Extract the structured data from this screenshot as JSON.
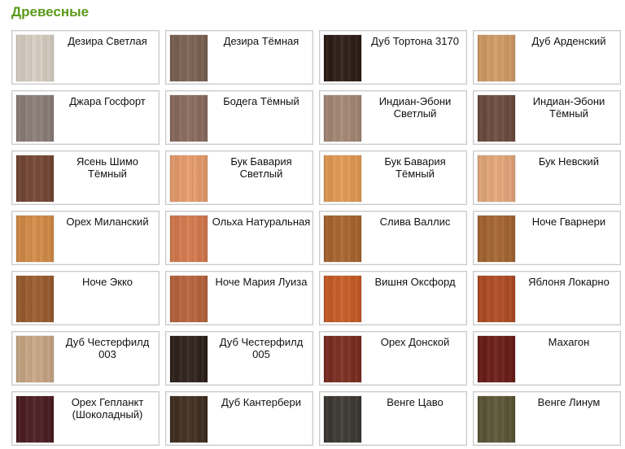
{
  "page": {
    "title": "Древесные"
  },
  "items": [
    {
      "name": "Дезира Светлая",
      "color": "#d9d0c3"
    },
    {
      "name": "Дезира Тёмная",
      "color": "#7a6150"
    },
    {
      "name": "Дуб Тортона 3170",
      "color": "#2a1a12"
    },
    {
      "name": "Дуб Арденский",
      "color": "#d29a62"
    },
    {
      "name": "Джара Госфорт",
      "color": "#8a7d77"
    },
    {
      "name": "Бодега Тёмный",
      "color": "#8a6a5d"
    },
    {
      "name": "Индиан-Эбони Светлый",
      "color": "#a58674"
    },
    {
      "name": "Индиан-Эбони Тёмный",
      "color": "#6b4a3c"
    },
    {
      "name": "Ясень Шимо Тёмный",
      "color": "#734532"
    },
    {
      "name": "Бук Бавария Светлый",
      "color": "#e89c6a"
    },
    {
      "name": "Бук Бавария Тёмный",
      "color": "#e39a52"
    },
    {
      "name": "Бук Невский",
      "color": "#e6a77a"
    },
    {
      "name": "Орех Миланский",
      "color": "#d48b45"
    },
    {
      "name": "Ольха Натуральная",
      "color": "#d6794c"
    },
    {
      "name": "Слива Валлис",
      "color": "#a8642c"
    },
    {
      "name": "Ноче Гварнери",
      "color": "#a5642e"
    },
    {
      "name": "Ноче Экко",
      "color": "#9a5a2c"
    },
    {
      "name": "Ноче Мария Луиза",
      "color": "#b8623a"
    },
    {
      "name": "Вишня Оксфорд",
      "color": "#c85a24"
    },
    {
      "name": "Яблоня Локарно",
      "color": "#b04a20"
    },
    {
      "name": "Дуб Честерфилд 003",
      "color": "#c8a784"
    },
    {
      "name": "Дуб Честерфилд 005",
      "color": "#2b1f18"
    },
    {
      "name": "Орех Донской",
      "color": "#7a2a1e"
    },
    {
      "name": "Махагон",
      "color": "#6a1a16"
    },
    {
      "name": "Орех Гепланкт (Шоколадный)",
      "color": "#4a1a1e"
    },
    {
      "name": "Дуб Кантербери",
      "color": "#3e2c1e"
    },
    {
      "name": "Венге Цаво",
      "color": "#3a3630"
    },
    {
      "name": "Венге Линум",
      "color": "#5a5434"
    }
  ]
}
